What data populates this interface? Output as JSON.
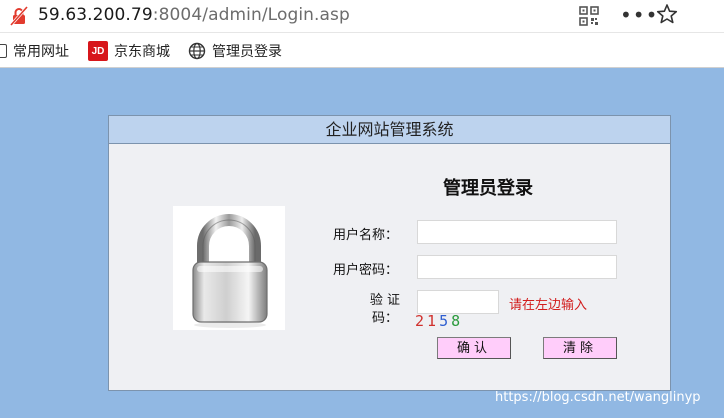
{
  "browser": {
    "url_host": "59.63.200.79",
    "url_rest": ":8004/admin/Login.asp",
    "icons": {
      "site": "site-info-crossed-icon",
      "qr": "qr-code-icon",
      "more": "more-options-icon",
      "star": "bookmark-star-icon"
    },
    "more_glyph": "•••",
    "bookmarks": [
      {
        "label": "常用网址",
        "icon": "folder-icon"
      },
      {
        "label": "京东商城",
        "icon": "jd-logo-icon",
        "logo_text": "JD"
      },
      {
        "label": "管理员登录",
        "icon": "globe-icon"
      }
    ]
  },
  "page": {
    "panel_title": "企业网站管理系统",
    "form_title": "管理员登录",
    "username_label": "用户名称：",
    "password_label": "用户密码：",
    "captcha_label": "验 证 码：",
    "captcha_hint": "请在左边输入",
    "captcha_digits": [
      {
        "d": "2",
        "color": "#d0312d"
      },
      {
        "d": "1",
        "color": "#d0312d"
      },
      {
        "d": "5",
        "color": "#2f5fd0"
      },
      {
        "d": "8",
        "color": "#2a9a3c"
      }
    ],
    "username_value": "",
    "password_value": "",
    "captcha_value": "",
    "confirm_button": "确认",
    "clear_button": "清除",
    "lock_icon": "padlock-icon",
    "watermark": "https://blog.csdn.net/wanglinyp"
  },
  "colors": {
    "page_bg": "#91b8e3",
    "panel_header": "#bdd3ee",
    "panel_body": "#eff0f3",
    "button_bg": "#ffcdfa",
    "hint": "#d21c1c"
  }
}
